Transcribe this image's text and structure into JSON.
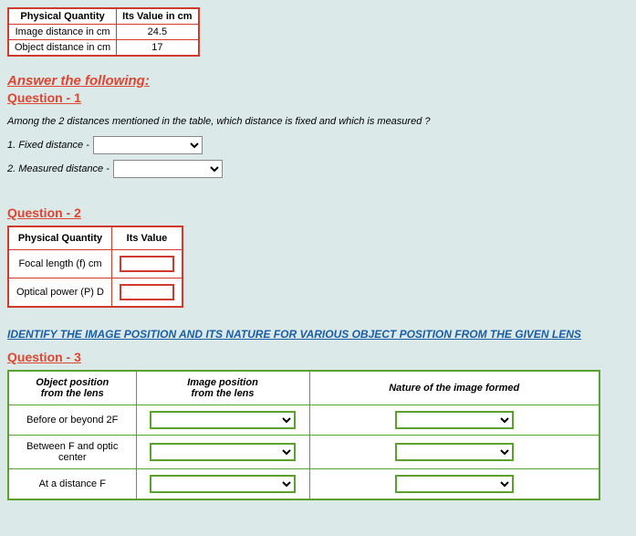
{
  "table1": {
    "headers": [
      "Physical Quantity",
      "Its Value in cm"
    ],
    "rows": [
      {
        "label": "Image distance in cm",
        "value": "24.5"
      },
      {
        "label": "Object distance in cm",
        "value": "17"
      }
    ]
  },
  "answerHeading": "Answer the following:",
  "q1": {
    "title": "Question - 1",
    "prompt": "Among the 2 distances mentioned in the table, which distance is fixed and  which is measured ?",
    "fixedLabel": "1. Fixed distance -",
    "measuredLabel": "2. Measured distance -"
  },
  "q2": {
    "title": "Question - 2",
    "headers": [
      "Physical Quantity",
      "Its Value"
    ],
    "rows": [
      {
        "label": "Focal length (f) cm"
      },
      {
        "label": "Optical power (P) D"
      }
    ]
  },
  "identify": "IDENTIFY THE IMAGE POSITION AND ITS NATURE FOR VARIOUS OBJECT POSITION FROM THE GIVEN LENS",
  "q3": {
    "title": "Question - 3",
    "headers": [
      "Object position\nfrom the lens",
      "Image position\nfrom the lens",
      "Nature of the image formed"
    ],
    "rows": [
      {
        "label": "Before or beyond 2F"
      },
      {
        "label": "Between F and optic center"
      },
      {
        "label": "At a distance F"
      }
    ]
  }
}
